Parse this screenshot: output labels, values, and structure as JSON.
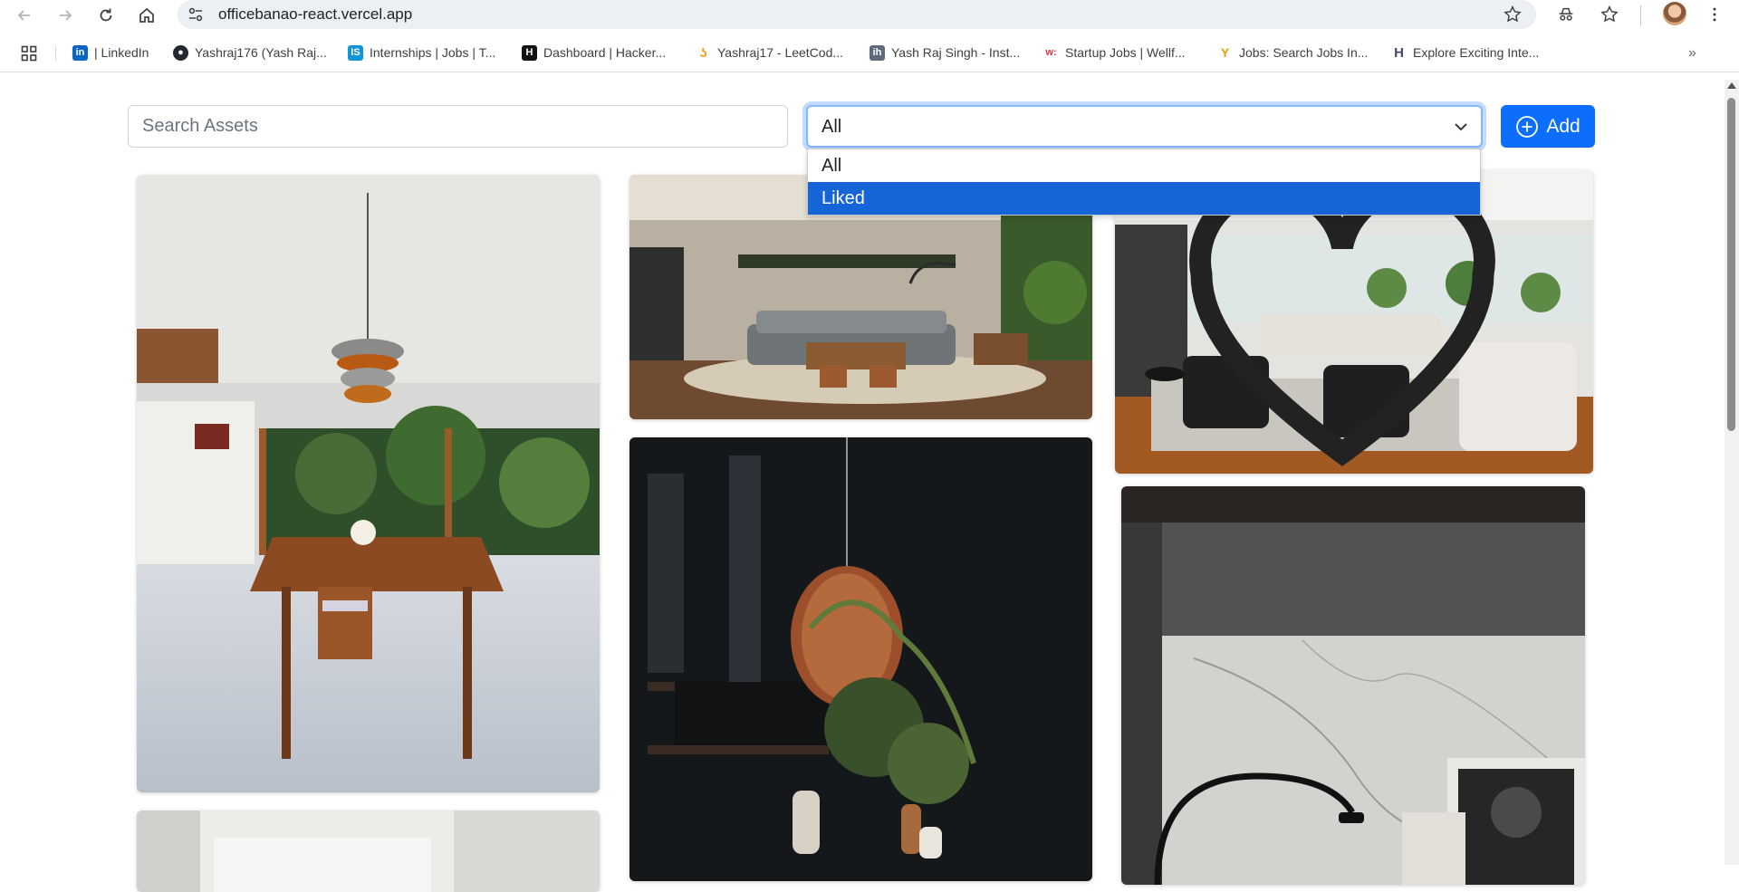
{
  "browser": {
    "url": "officebanao-react.vercel.app",
    "bookmarks": [
      {
        "label": "| LinkedIn",
        "icon": "linkedin-icon",
        "color": "#0a66c2"
      },
      {
        "label": "Yashraj176 (Yash Raj...",
        "icon": "github-icon",
        "color": "#24292f"
      },
      {
        "label": "Internships | Jobs | T...",
        "icon": "internshala-icon",
        "color": "#1295d8"
      },
      {
        "label": "Dashboard | Hacker...",
        "icon": "hackerrank-icon",
        "color": "#111111"
      },
      {
        "label": "Yashraj17 - LeetCod...",
        "icon": "leetcode-icon",
        "color": "#f89f1b"
      },
      {
        "label": "Yash Raj Singh - Inst...",
        "icon": "instahyre-icon",
        "color": "#5f6b7a"
      },
      {
        "label": "Startup Jobs | Wellf...",
        "icon": "wellfound-icon",
        "color": "#ec2e3a"
      },
      {
        "label": "Jobs: Search Jobs In...",
        "icon": "jobs-icon",
        "color": "#e0a100"
      },
      {
        "label": "Explore Exciting Inte...",
        "icon": "unstop-icon",
        "color": "#3b4a6b"
      }
    ]
  },
  "toolbar": {
    "search_placeholder": "Search Assets",
    "filter_selected": "All",
    "filter_options": [
      "All",
      "Liked"
    ],
    "highlighted_option": "Liked",
    "add_label": "Add"
  },
  "colors": {
    "primary": "#0d6efd",
    "option_highlight": "#1565d8",
    "focus_border": "#86b7fe"
  },
  "gallery": {
    "images": [
      {
        "name": "dining-room-pendant-lamp",
        "liked": false
      },
      {
        "name": "living-room-grey-sofa",
        "liked": false
      },
      {
        "name": "open-lounge-black-armchairs",
        "liked": false
      },
      {
        "name": "dark-kitchen-copper-pendant",
        "liked": false
      },
      {
        "name": "marble-wall-arc-lamp",
        "liked": false
      },
      {
        "name": "white-room-partial",
        "liked": false
      }
    ]
  }
}
